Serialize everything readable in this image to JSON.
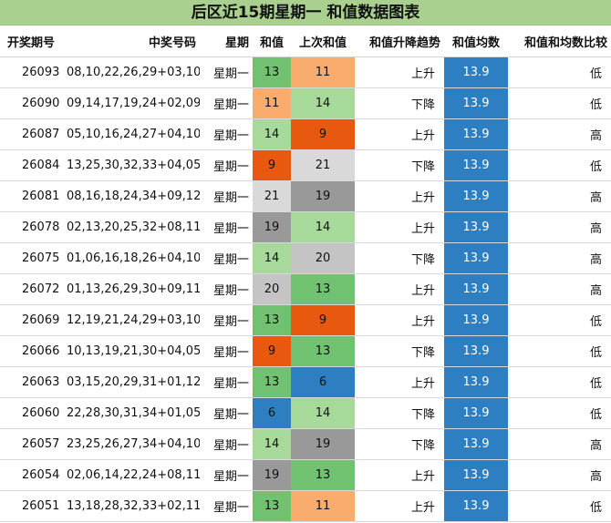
{
  "title": "后区近15期星期一  和值数据图表",
  "headers": [
    "开奖期号",
    "中奖号码",
    "星期",
    "和值",
    "上次和值",
    "和值升降趋势",
    "和值均数",
    "和值和均数比较"
  ],
  "rows": [
    {
      "issue": "26093",
      "numbers": "08,10,22,26,29+03,10",
      "weekday": "星期一",
      "sum": "13",
      "prev_sum": "11",
      "trend": "上升",
      "avg": "13.9",
      "cmp": "低",
      "sum_color": "#70c270",
      "prev_color": "#f9ac6d"
    },
    {
      "issue": "26090",
      "numbers": "09,14,17,19,24+02,09",
      "weekday": "星期一",
      "sum": "11",
      "prev_sum": "14",
      "trend": "下降",
      "avg": "13.9",
      "cmp": "低",
      "sum_color": "#f9ac6d",
      "prev_color": "#a6d99a"
    },
    {
      "issue": "26087",
      "numbers": "05,10,16,24,27+04,10",
      "weekday": "星期一",
      "sum": "14",
      "prev_sum": "9",
      "trend": "上升",
      "avg": "13.9",
      "cmp": "高",
      "sum_color": "#a6d99a",
      "prev_color": "#e8580e"
    },
    {
      "issue": "26084",
      "numbers": "13,25,30,32,33+04,05",
      "weekday": "星期一",
      "sum": "9",
      "prev_sum": "21",
      "trend": "下降",
      "avg": "13.9",
      "cmp": "低",
      "sum_color": "#e8580e",
      "prev_color": "#d9d9d9"
    },
    {
      "issue": "26081",
      "numbers": "08,16,18,24,34+09,12",
      "weekday": "星期一",
      "sum": "21",
      "prev_sum": "19",
      "trend": "上升",
      "avg": "13.9",
      "cmp": "高",
      "sum_color": "#d9d9d9",
      "prev_color": "#999999"
    },
    {
      "issue": "26078",
      "numbers": "02,13,20,25,32+08,11",
      "weekday": "星期一",
      "sum": "19",
      "prev_sum": "14",
      "trend": "上升",
      "avg": "13.9",
      "cmp": "高",
      "sum_color": "#999999",
      "prev_color": "#a6d99a"
    },
    {
      "issue": "26075",
      "numbers": "01,06,16,18,26+04,10",
      "weekday": "星期一",
      "sum": "14",
      "prev_sum": "20",
      "trend": "下降",
      "avg": "13.9",
      "cmp": "高",
      "sum_color": "#a6d99a",
      "prev_color": "#c4c4c4"
    },
    {
      "issue": "26072",
      "numbers": "01,13,26,29,30+09,11",
      "weekday": "星期一",
      "sum": "20",
      "prev_sum": "13",
      "trend": "上升",
      "avg": "13.9",
      "cmp": "高",
      "sum_color": "#c4c4c4",
      "prev_color": "#70c270"
    },
    {
      "issue": "26069",
      "numbers": "12,19,21,24,29+03,10",
      "weekday": "星期一",
      "sum": "13",
      "prev_sum": "9",
      "trend": "上升",
      "avg": "13.9",
      "cmp": "低",
      "sum_color": "#70c270",
      "prev_color": "#e8580e"
    },
    {
      "issue": "26066",
      "numbers": "10,13,19,21,30+04,05",
      "weekday": "星期一",
      "sum": "9",
      "prev_sum": "13",
      "trend": "下降",
      "avg": "13.9",
      "cmp": "低",
      "sum_color": "#e8580e",
      "prev_color": "#70c270"
    },
    {
      "issue": "26063",
      "numbers": "03,15,20,29,31+01,12",
      "weekday": "星期一",
      "sum": "13",
      "prev_sum": "6",
      "trend": "上升",
      "avg": "13.9",
      "cmp": "低",
      "sum_color": "#70c270",
      "prev_color": "#2e7fc2"
    },
    {
      "issue": "26060",
      "numbers": "22,28,30,31,34+01,05",
      "weekday": "星期一",
      "sum": "6",
      "prev_sum": "14",
      "trend": "下降",
      "avg": "13.9",
      "cmp": "低",
      "sum_color": "#2e7fc2",
      "prev_color": "#a6d99a"
    },
    {
      "issue": "26057",
      "numbers": "23,25,26,27,34+04,10",
      "weekday": "星期一",
      "sum": "14",
      "prev_sum": "19",
      "trend": "下降",
      "avg": "13.9",
      "cmp": "高",
      "sum_color": "#a6d99a",
      "prev_color": "#999999"
    },
    {
      "issue": "26054",
      "numbers": "02,06,14,22,24+08,11",
      "weekday": "星期一",
      "sum": "19",
      "prev_sum": "13",
      "trend": "上升",
      "avg": "13.9",
      "cmp": "高",
      "sum_color": "#999999",
      "prev_color": "#70c270"
    },
    {
      "issue": "26051",
      "numbers": "13,18,28,32,33+02,11",
      "weekday": "星期一",
      "sum": "13",
      "prev_sum": "11",
      "trend": "上升",
      "avg": "13.9",
      "cmp": "低",
      "sum_color": "#70c270",
      "prev_color": "#f9ac6d"
    }
  ],
  "colors": {
    "title_bg": "#a9d08e",
    "avg_bg": "#2e7fc2",
    "avg_text": "#ffffff"
  }
}
